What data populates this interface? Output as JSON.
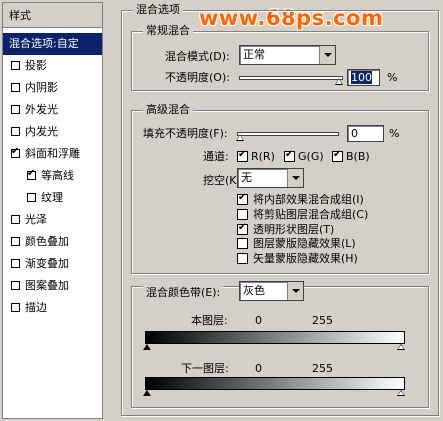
{
  "watermark": "www.68ps.com",
  "styles_panel": {
    "header": "样式",
    "items": [
      {
        "label": "混合选项:自定",
        "selected": true
      },
      {
        "label": "投影",
        "checked": false
      },
      {
        "label": "内阴影",
        "checked": false
      },
      {
        "label": "外发光",
        "checked": false
      },
      {
        "label": "内发光",
        "checked": false
      },
      {
        "label": "斜面和浮雕",
        "checked": true
      },
      {
        "label": "等高线",
        "checked": true
      },
      {
        "label": "纹理",
        "checked": false
      },
      {
        "label": "光泽",
        "checked": false
      },
      {
        "label": "颜色叠加",
        "checked": false
      },
      {
        "label": "渐变叠加",
        "checked": false
      },
      {
        "label": "图案叠加",
        "checked": false
      },
      {
        "label": "描边",
        "checked": false
      }
    ]
  },
  "blending": {
    "title": "混合选项",
    "general": {
      "title": "常规混合",
      "mode_label": "混合模式(D):",
      "mode_value": "正常",
      "opacity_label": "不透明度(O):",
      "opacity_value": "100",
      "opacity_unit": "%",
      "opacity_fraction": 1.0
    },
    "advanced": {
      "title": "高级混合",
      "fill_label": "填充不透明度(F):",
      "fill_value": "0",
      "fill_unit": "%",
      "fill_fraction": 0.0,
      "channels_label": "通道:",
      "channel_r": "R(R)",
      "channel_g": "G(G)",
      "channel_b": "B(B)",
      "knockout_label": "挖空(K):",
      "knockout_value": "无",
      "options": [
        {
          "label": "将内部效果混合成组(I)",
          "checked": true
        },
        {
          "label": "将剪贴图层混合成组(C)",
          "checked": false
        },
        {
          "label": "透明形状图层(T)",
          "checked": true
        },
        {
          "label": "图层蒙版隐藏效果(L)",
          "checked": false
        },
        {
          "label": "矢量蒙版隐藏效果(H)",
          "checked": false
        }
      ]
    },
    "blend_if": {
      "label": "混合颜色带(E):",
      "value": "灰色",
      "this_layer_label": "本图层:",
      "this_layer_min": "0",
      "this_layer_max": "255",
      "underlying_label": "下一图层:",
      "underlying_min": "0",
      "underlying_max": "255"
    }
  }
}
